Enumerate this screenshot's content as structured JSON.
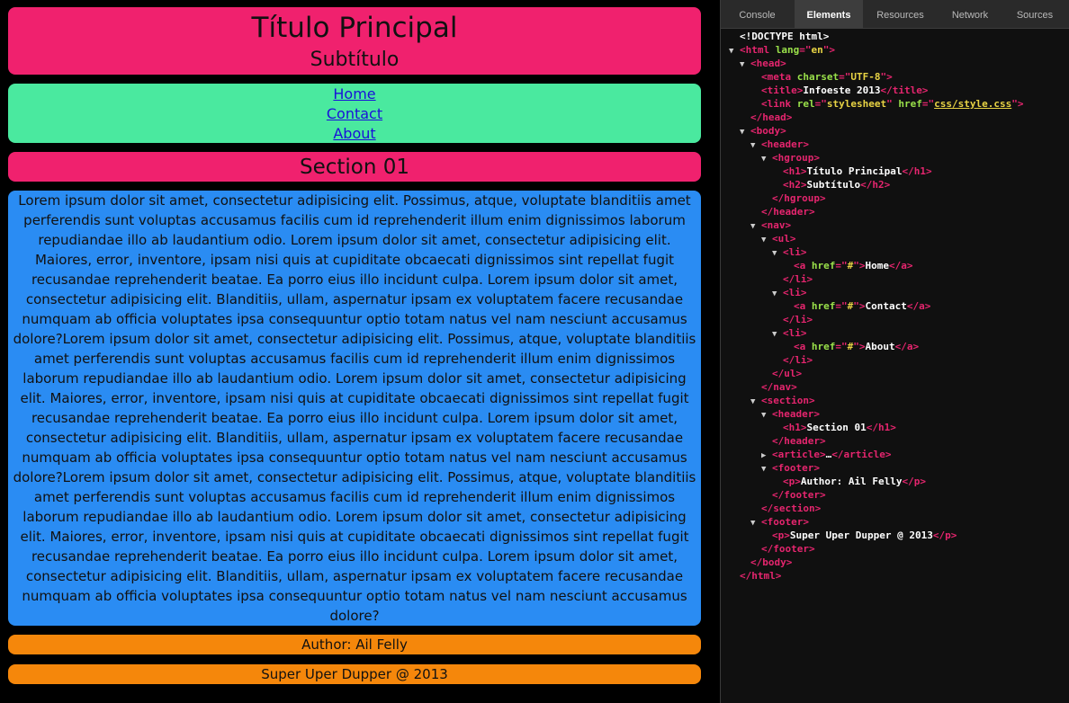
{
  "page": {
    "h1": "Título Principal",
    "h2": "Subtítulo",
    "nav": [
      "Home",
      "Contact",
      "About"
    ],
    "section_title": "Section 01",
    "article_text": "Lorem ipsum dolor sit amet, consectetur adipisicing elit. Possimus, atque, voluptate blanditiis amet perferendis sunt voluptas accusamus facilis cum id reprehenderit illum enim dignissimos laborum repudiandae illo ab laudantium odio. Lorem ipsum dolor sit amet, consectetur adipisicing elit. Maiores, error, inventore, ipsam nisi quis at cupiditate obcaecati dignissimos sint repellat fugit recusandae reprehenderit beatae. Ea porro eius illo incidunt culpa. Lorem ipsum dolor sit amet, consectetur adipisicing elit. Blanditiis, ullam, aspernatur ipsam ex voluptatem facere recusandae numquam ab officia voluptates ipsa consequuntur optio totam natus vel nam nesciunt accusamus dolore?Lorem ipsum dolor sit amet, consectetur adipisicing elit. Possimus, atque, voluptate blanditiis amet perferendis sunt voluptas accusamus facilis cum id reprehenderit illum enim dignissimos laborum repudiandae illo ab laudantium odio. Lorem ipsum dolor sit amet, consectetur adipisicing elit. Maiores, error, inventore, ipsam nisi quis at cupiditate obcaecati dignissimos sint repellat fugit recusandae reprehenderit beatae. Ea porro eius illo incidunt culpa. Lorem ipsum dolor sit amet, consectetur adipisicing elit. Blanditiis, ullam, aspernatur ipsam ex voluptatem facere recusandae numquam ab officia voluptates ipsa consequuntur optio totam natus vel nam nesciunt accusamus dolore?Lorem ipsum dolor sit amet, consectetur adipisicing elit. Possimus, atque, voluptate blanditiis amet perferendis sunt voluptas accusamus facilis cum id reprehenderit illum enim dignissimos laborum repudiandae illo ab laudantium odio. Lorem ipsum dolor sit amet, consectetur adipisicing elit. Maiores, error, inventore, ipsam nisi quis at cupiditate obcaecati dignissimos sint repellat fugit recusandae reprehenderit beatae. Ea porro eius illo incidunt culpa. Lorem ipsum dolor sit amet, consectetur adipisicing elit. Blanditiis, ullam, aspernatur ipsam ex voluptatem facere recusandae numquam ab officia voluptates ipsa consequuntur optio totam natus vel nam nesciunt accusamus dolore?",
    "author": "Author: Ail Felly",
    "footer": "Super Uper Dupper @ 2013"
  },
  "colors": {
    "header": "#f0216e",
    "nav": "#4ae99f",
    "article": "#2a8cf3",
    "footer": "#f5870b"
  },
  "devtools": {
    "tabs": [
      "Console",
      "Elements",
      "Resources",
      "Network",
      "Sources"
    ],
    "active_tab": "Elements",
    "tree": [
      {
        "d": 0,
        "t": "",
        "s": [
          [
            "tx",
            "<!DOCTYPE html>"
          ]
        ]
      },
      {
        "d": 0,
        "t": "down",
        "s": [
          [
            "tg",
            "<html "
          ],
          [
            "an",
            "lang"
          ],
          [
            "tg",
            "=\""
          ],
          [
            "av",
            "en"
          ],
          [
            "tg",
            "\">"
          ]
        ]
      },
      {
        "d": 1,
        "t": "down",
        "s": [
          [
            "tg",
            "<head>"
          ]
        ]
      },
      {
        "d": 2,
        "t": "",
        "s": [
          [
            "tg",
            "<meta "
          ],
          [
            "an",
            "charset"
          ],
          [
            "tg",
            "=\""
          ],
          [
            "av",
            "UTF-8"
          ],
          [
            "tg",
            "\">"
          ]
        ]
      },
      {
        "d": 2,
        "t": "",
        "s": [
          [
            "tg",
            "<title>"
          ],
          [
            "tx",
            "Infoeste 2013"
          ],
          [
            "tg",
            "</title>"
          ]
        ]
      },
      {
        "d": 2,
        "t": "",
        "s": [
          [
            "tg",
            "<link "
          ],
          [
            "an",
            "rel"
          ],
          [
            "tg",
            "=\""
          ],
          [
            "av",
            "stylesheet"
          ],
          [
            "tg",
            "\" "
          ],
          [
            "an",
            "href"
          ],
          [
            "tg",
            "=\""
          ],
          [
            "avl",
            "css/style.css"
          ],
          [
            "tg",
            "\">"
          ]
        ]
      },
      {
        "d": 1,
        "t": "",
        "s": [
          [
            "tg",
            "</head>"
          ]
        ]
      },
      {
        "d": 1,
        "t": "down",
        "s": [
          [
            "tg",
            "<body>"
          ]
        ]
      },
      {
        "d": 2,
        "t": "down",
        "s": [
          [
            "tg",
            "<header>"
          ]
        ]
      },
      {
        "d": 3,
        "t": "down",
        "s": [
          [
            "tg",
            "<hgroup>"
          ]
        ]
      },
      {
        "d": 4,
        "t": "",
        "s": [
          [
            "tg",
            "<h1>"
          ],
          [
            "tx",
            "Título Principal"
          ],
          [
            "tg",
            "</h1>"
          ]
        ]
      },
      {
        "d": 4,
        "t": "",
        "s": [
          [
            "tg",
            "<h2>"
          ],
          [
            "tx",
            "Subtítulo"
          ],
          [
            "tg",
            "</h2>"
          ]
        ]
      },
      {
        "d": 3,
        "t": "",
        "s": [
          [
            "tg",
            "</hgroup>"
          ]
        ]
      },
      {
        "d": 2,
        "t": "",
        "s": [
          [
            "tg",
            "</header>"
          ]
        ]
      },
      {
        "d": 2,
        "t": "down",
        "s": [
          [
            "tg",
            "<nav>"
          ]
        ]
      },
      {
        "d": 3,
        "t": "down",
        "s": [
          [
            "tg",
            "<ul>"
          ]
        ]
      },
      {
        "d": 4,
        "t": "down",
        "s": [
          [
            "tg",
            "<li>"
          ]
        ]
      },
      {
        "d": 5,
        "t": "",
        "s": [
          [
            "tg",
            "<a "
          ],
          [
            "an",
            "href"
          ],
          [
            "tg",
            "=\""
          ],
          [
            "av",
            "#"
          ],
          [
            "tg",
            "\">"
          ],
          [
            "tx",
            "Home"
          ],
          [
            "tg",
            "</a>"
          ]
        ]
      },
      {
        "d": 4,
        "t": "",
        "s": [
          [
            "tg",
            "</li>"
          ]
        ]
      },
      {
        "d": 4,
        "t": "down",
        "s": [
          [
            "tg",
            "<li>"
          ]
        ]
      },
      {
        "d": 5,
        "t": "",
        "s": [
          [
            "tg",
            "<a "
          ],
          [
            "an",
            "href"
          ],
          [
            "tg",
            "=\""
          ],
          [
            "av",
            "#"
          ],
          [
            "tg",
            "\">"
          ],
          [
            "tx",
            "Contact"
          ],
          [
            "tg",
            "</a>"
          ]
        ]
      },
      {
        "d": 4,
        "t": "",
        "s": [
          [
            "tg",
            "</li>"
          ]
        ]
      },
      {
        "d": 4,
        "t": "down",
        "s": [
          [
            "tg",
            "<li>"
          ]
        ]
      },
      {
        "d": 5,
        "t": "",
        "s": [
          [
            "tg",
            "<a "
          ],
          [
            "an",
            "href"
          ],
          [
            "tg",
            "=\""
          ],
          [
            "av",
            "#"
          ],
          [
            "tg",
            "\">"
          ],
          [
            "tx",
            "About"
          ],
          [
            "tg",
            "</a>"
          ]
        ]
      },
      {
        "d": 4,
        "t": "",
        "s": [
          [
            "tg",
            "</li>"
          ]
        ]
      },
      {
        "d": 3,
        "t": "",
        "s": [
          [
            "tg",
            "</ul>"
          ]
        ]
      },
      {
        "d": 2,
        "t": "",
        "s": [
          [
            "tg",
            "</nav>"
          ]
        ]
      },
      {
        "d": 2,
        "t": "down",
        "s": [
          [
            "tg",
            "<section>"
          ]
        ]
      },
      {
        "d": 3,
        "t": "down",
        "s": [
          [
            "tg",
            "<header>"
          ]
        ]
      },
      {
        "d": 4,
        "t": "",
        "s": [
          [
            "tg",
            "<h1>"
          ],
          [
            "tx",
            "Section 01"
          ],
          [
            "tg",
            "</h1>"
          ]
        ]
      },
      {
        "d": 3,
        "t": "",
        "s": [
          [
            "tg",
            "</header>"
          ]
        ]
      },
      {
        "d": 3,
        "t": "right",
        "s": [
          [
            "tg",
            "<article>"
          ],
          [
            "tx",
            "…"
          ],
          [
            "tg",
            "</article>"
          ]
        ]
      },
      {
        "d": 3,
        "t": "down",
        "s": [
          [
            "tg",
            "<footer>"
          ]
        ]
      },
      {
        "d": 4,
        "t": "",
        "s": [
          [
            "tg",
            "<p>"
          ],
          [
            "tx",
            "Author: Ail Felly"
          ],
          [
            "tg",
            "</p>"
          ]
        ]
      },
      {
        "d": 3,
        "t": "",
        "s": [
          [
            "tg",
            "</footer>"
          ]
        ]
      },
      {
        "d": 2,
        "t": "",
        "s": [
          [
            "tg",
            "</section>"
          ]
        ]
      },
      {
        "d": 2,
        "t": "down",
        "s": [
          [
            "tg",
            "<footer>"
          ]
        ]
      },
      {
        "d": 3,
        "t": "",
        "s": [
          [
            "tg",
            "<p>"
          ],
          [
            "tx",
            "Super Uper Dupper @ 2013"
          ],
          [
            "tg",
            "</p>"
          ]
        ]
      },
      {
        "d": 2,
        "t": "",
        "s": [
          [
            "tg",
            "</footer>"
          ]
        ]
      },
      {
        "d": 1,
        "t": "",
        "s": [
          [
            "tg",
            "</body>"
          ]
        ]
      },
      {
        "d": 0,
        "t": "",
        "s": [
          [
            "tg",
            "</html>"
          ]
        ]
      }
    ]
  }
}
